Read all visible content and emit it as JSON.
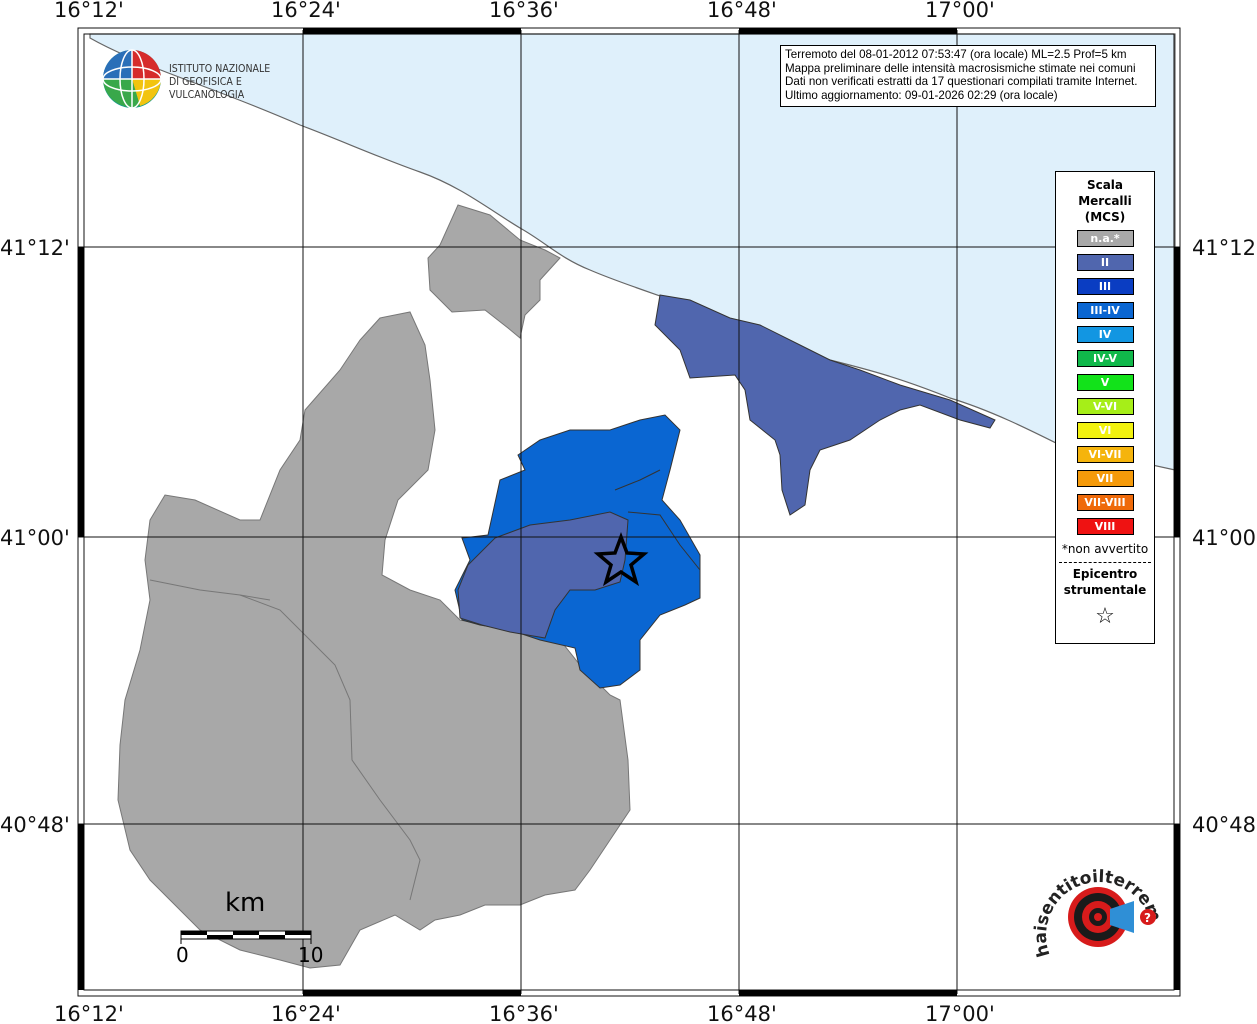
{
  "axes": {
    "top_longitudes": [
      "16°12'",
      "16°24'",
      "16°36'",
      "16°48'",
      "17°00'"
    ],
    "bottom_longitudes": [
      "16°12'",
      "16°24'",
      "16°36'",
      "16°48'",
      "17°00'"
    ],
    "left_latitudes": [
      "41°12'",
      "41°00'",
      "40°48'"
    ],
    "right_latitudes": [
      "41°12'",
      "41°00'",
      "40°48'"
    ]
  },
  "info": {
    "line1": "Terremoto del 08-01-2012 07:53:47 (ora locale) ML=2.5 Prof=5 km",
    "line2": "Mappa preliminare delle intensità macrosismiche stimate nei comuni",
    "line3": "Dati non verificati estratti da 17 questionari compilati tramite Internet.",
    "line4": "Ultimo aggiornamento: 09-01-2026 02:29 (ora locale)"
  },
  "logo": {
    "line1": "ISTITUTO NAZIONALE",
    "line2": "DI GEOFISICA E VULCANOLOGIA"
  },
  "legend": {
    "title_l1": "Scala",
    "title_l2": "Mercalli",
    "title_l3": "(MCS)",
    "items": [
      {
        "label": "n.a.*",
        "color": "#a8a8a8"
      },
      {
        "label": "II",
        "color": "#5066ae"
      },
      {
        "label": "III",
        "color": "#0a3dc2"
      },
      {
        "label": "III-IV",
        "color": "#0a66d2"
      },
      {
        "label": "IV",
        "color": "#1296e2"
      },
      {
        "label": "IV-V",
        "color": "#10b84a"
      },
      {
        "label": "V",
        "color": "#12e21a"
      },
      {
        "label": "V-VI",
        "color": "#a6ee18"
      },
      {
        "label": "VI",
        "color": "#f2f20e"
      },
      {
        "label": "VI-VII",
        "color": "#f5b40c"
      },
      {
        "label": "VII",
        "color": "#f59a0a"
      },
      {
        "label": "VII-VIII",
        "color": "#ef6a0a"
      },
      {
        "label": "VIII",
        "color": "#ef1212"
      }
    ],
    "note": "*non avvertito",
    "epi_l1": "Epicentro",
    "epi_l2": "strumentale",
    "star": "☆"
  },
  "scale": {
    "title": "km",
    "start": "0",
    "end": "10"
  },
  "colors": {
    "sea": "#dff0fb",
    "not_available": "#a8a8a8",
    "intensity_II": "#5066ae",
    "intensity_III_IV": "#0a66d2"
  },
  "badge": {
    "text": "haisentitoilterremoto.it",
    "url_prefix": "www."
  }
}
